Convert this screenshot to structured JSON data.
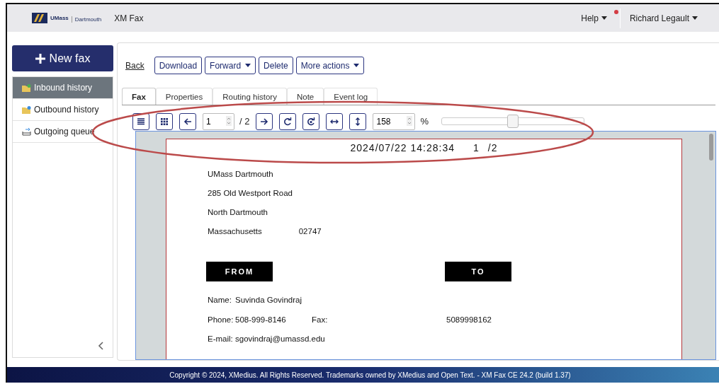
{
  "header": {
    "logo_primary": "UMass",
    "logo_secondary": "Dartmouth",
    "app_title": "XM Fax",
    "help": "Help",
    "help_notification": true,
    "user": "Richard Legault"
  },
  "sidebar": {
    "new_button": "New fax",
    "items": [
      {
        "label": "Inbound history",
        "kind": "inbound",
        "selected": true
      },
      {
        "label": "Outbound history",
        "kind": "outbound",
        "selected": false
      },
      {
        "label": "Outgoing queue",
        "kind": "queue",
        "selected": false
      }
    ]
  },
  "actions": {
    "back": "Back",
    "buttons": [
      {
        "label": "Download",
        "dropdown": false
      },
      {
        "label": "Forward",
        "dropdown": true
      },
      {
        "label": "Delete",
        "dropdown": false
      },
      {
        "label": "More actions",
        "dropdown": true
      }
    ]
  },
  "tabs": [
    {
      "label": "Fax",
      "selected": true
    },
    {
      "label": "Properties",
      "selected": false
    },
    {
      "label": "Routing history",
      "selected": false
    },
    {
      "label": "Note",
      "selected": false
    },
    {
      "label": "Event log",
      "selected": false
    }
  ],
  "viewer_toolbar": [
    {
      "kind": "list"
    },
    {
      "kind": "grid"
    },
    {
      "kind": "prev"
    },
    {
      "kind": "page",
      "value": "1",
      "total": "/ 2"
    },
    {
      "kind": "next"
    },
    {
      "kind": "rotate_right"
    },
    {
      "kind": "rotate_alt"
    },
    {
      "kind": "fit_width"
    },
    {
      "kind": "fit_height"
    },
    {
      "kind": "zoom",
      "value": "158",
      "unit": "%"
    },
    {
      "kind": "slider",
      "level": 0.5
    }
  ],
  "document": {
    "timestamp": "2024/07/22 14:28:34",
    "page_number": "1",
    "page_total": "/2",
    "address_lines": [
      "UMass Dartmouth",
      "285 Old Westport Road",
      "North Dartmouth"
    ],
    "state": "Massachusetts",
    "zip": "02747",
    "from_label": "FROM",
    "to_label": "TO",
    "fields": [
      {
        "label": "Name:",
        "value": "Suvinda Govindraj"
      },
      {
        "label": "Phone:",
        "value": "508-999-8146",
        "extra_label": "Fax:",
        "extra_value": "5089998162"
      },
      {
        "label": "E-mail:",
        "value": "sgovindraj@umassd.edu"
      }
    ]
  },
  "footer": "Copyright © 2024, XMedius. All Rights Reserved. Trademarks owned by XMedius and Open Text. - XM Fax CE 24.2 (build 1.37)"
}
